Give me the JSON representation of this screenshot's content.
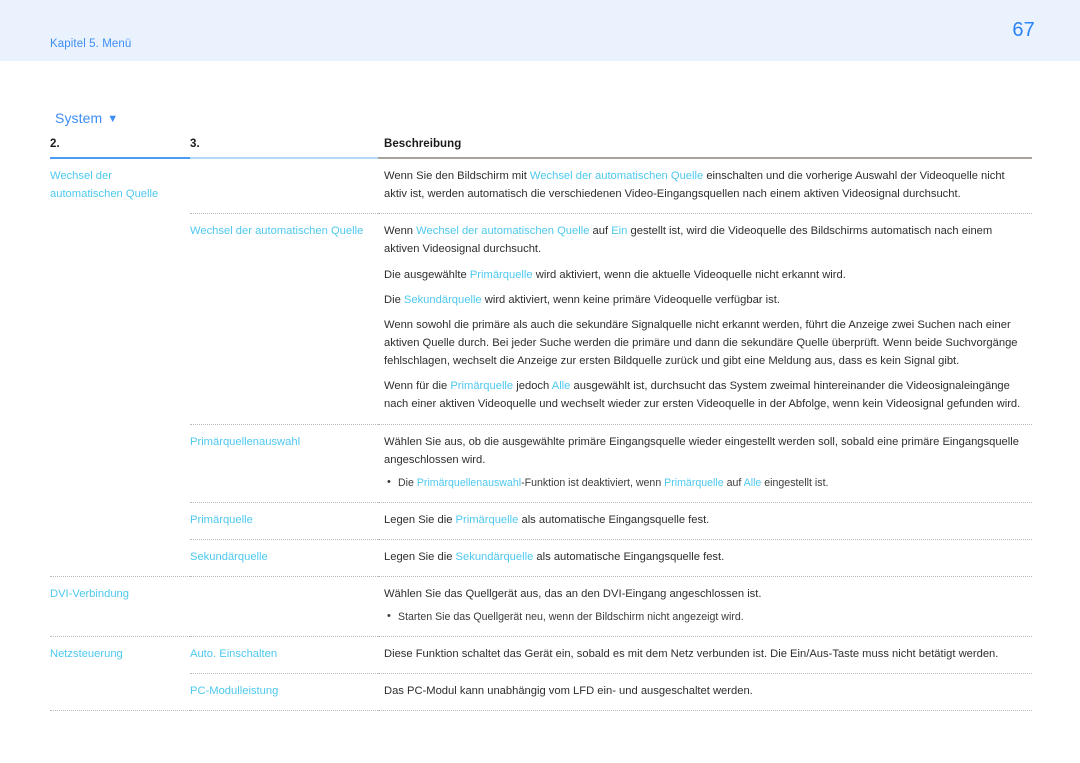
{
  "header": {
    "chapter": "Kapitel 5. Menü",
    "page_number": "67"
  },
  "section": {
    "title": "System",
    "caret": "▼"
  },
  "table": {
    "columns": [
      "2.",
      "3.",
      "Beschreibung"
    ],
    "rows": [
      {
        "level1": "Wechsel der automatischen Quelle",
        "level2": "",
        "paragraphs": [
          {
            "parts": [
              {
                "t": "Wenn Sie den Bildschirm mit ",
                "hl": false
              },
              {
                "t": "Wechsel der automatischen Quelle",
                "hl": true
              },
              {
                "t": " einschalten und die vorherige Auswahl der Videoquelle nicht aktiv ist, werden automatisch die verschiedenen Video-Eingangsquellen nach einem aktiven Videosignal durchsucht.",
                "hl": false
              }
            ]
          }
        ],
        "bullets": []
      },
      {
        "level1": "",
        "level2": "Wechsel der automatischen Quelle",
        "paragraphs": [
          {
            "parts": [
              {
                "t": "Wenn ",
                "hl": false
              },
              {
                "t": "Wechsel der automatischen Quelle",
                "hl": true
              },
              {
                "t": " auf ",
                "hl": false
              },
              {
                "t": "Ein",
                "hl": true
              },
              {
                "t": " gestellt ist, wird die Videoquelle des Bildschirms automatisch nach einem aktiven Videosignal durchsucht.",
                "hl": false
              }
            ]
          },
          {
            "parts": [
              {
                "t": "Die ausgewählte ",
                "hl": false
              },
              {
                "t": "Primärquelle",
                "hl": true
              },
              {
                "t": " wird aktiviert, wenn die aktuelle Videoquelle nicht erkannt wird.",
                "hl": false
              }
            ]
          },
          {
            "parts": [
              {
                "t": "Die ",
                "hl": false
              },
              {
                "t": "Sekundärquelle",
                "hl": true
              },
              {
                "t": " wird aktiviert, wenn keine primäre Videoquelle verfügbar ist.",
                "hl": false
              }
            ]
          },
          {
            "parts": [
              {
                "t": "Wenn sowohl die primäre als auch die sekundäre Signalquelle nicht erkannt werden, führt die Anzeige zwei Suchen nach einer aktiven Quelle durch. Bei jeder Suche werden die primäre und dann die sekundäre Quelle überprüft. Wenn beide Suchvorgänge fehlschlagen, wechselt die Anzeige zur ersten Bildquelle zurück und gibt eine Meldung aus, dass es kein Signal gibt.",
                "hl": false
              }
            ]
          },
          {
            "parts": [
              {
                "t": "Wenn für die ",
                "hl": false
              },
              {
                "t": "Primärquelle",
                "hl": true
              },
              {
                "t": " jedoch ",
                "hl": false
              },
              {
                "t": "Alle",
                "hl": true
              },
              {
                "t": " ausgewählt ist, durchsucht das System zweimal hintereinander die Videosignaleingänge nach einer aktiven Videoquelle und wechselt wieder zur ersten Videoquelle in der Abfolge, wenn kein Videosignal gefunden wird.",
                "hl": false
              }
            ]
          }
        ],
        "bullets": []
      },
      {
        "level1": "",
        "level2": "Primärquellenauswahl",
        "paragraphs": [
          {
            "parts": [
              {
                "t": "Wählen Sie aus, ob die ausgewählte primäre Eingangsquelle wieder eingestellt werden soll, sobald eine primäre Eingangsquelle angeschlossen wird.",
                "hl": false
              }
            ]
          }
        ],
        "bullets": [
          {
            "parts": [
              {
                "t": "Die ",
                "hl": false
              },
              {
                "t": "Primärquellenauswahl",
                "hl": true
              },
              {
                "t": "-Funktion ist deaktiviert, wenn ",
                "hl": false
              },
              {
                "t": "Primärquelle",
                "hl": true
              },
              {
                "t": " auf ",
                "hl": false
              },
              {
                "t": "Alle",
                "hl": true
              },
              {
                "t": " eingestellt ist.",
                "hl": false
              }
            ]
          }
        ]
      },
      {
        "level1": "",
        "level2": "Primärquelle",
        "paragraphs": [
          {
            "parts": [
              {
                "t": "Legen Sie die ",
                "hl": false
              },
              {
                "t": "Primärquelle",
                "hl": true
              },
              {
                "t": " als automatische Eingangsquelle fest.",
                "hl": false
              }
            ]
          }
        ],
        "bullets": []
      },
      {
        "level1": "",
        "level2": "Sekundärquelle",
        "paragraphs": [
          {
            "parts": [
              {
                "t": "Legen Sie die ",
                "hl": false
              },
              {
                "t": "Sekundärquelle",
                "hl": true
              },
              {
                "t": " als automatische Eingangsquelle fest.",
                "hl": false
              }
            ]
          }
        ],
        "bullets": []
      },
      {
        "level1": "DVI-Verbindung",
        "level2": "",
        "paragraphs": [
          {
            "parts": [
              {
                "t": "Wählen Sie das Quellgerät aus, das an den DVI-Eingang angeschlossen ist.",
                "hl": false
              }
            ]
          }
        ],
        "bullets": [
          {
            "parts": [
              {
                "t": "Starten Sie das Quellgerät neu, wenn der Bildschirm nicht angezeigt wird.",
                "hl": false
              }
            ]
          }
        ]
      },
      {
        "level1": "Netzsteuerung",
        "level2": "Auto. Einschalten",
        "paragraphs": [
          {
            "parts": [
              {
                "t": "Diese Funktion schaltet das Gerät ein, sobald es mit dem Netz verbunden ist. Die Ein/Aus-Taste muss nicht betätigt werden.",
                "hl": false
              }
            ]
          }
        ],
        "bullets": []
      },
      {
        "level1": "",
        "level2": "PC-Modulleistung",
        "paragraphs": [
          {
            "parts": [
              {
                "t": "Das PC-Modul kann unabhängig vom LFD ein- und ausgeschaltet werden.",
                "hl": false
              }
            ]
          }
        ],
        "bullets": []
      }
    ]
  },
  "colors": {
    "header_band": "#eaf2fd",
    "chapter_text": "#3d8df5",
    "page_number": "#2a84f7",
    "section_title": "#3d8df5",
    "highlight_term": "#4ec8ee",
    "rule_col1": "#4a9bf7",
    "rule_col2": "#b4d8fc",
    "rule_col3": "#a8a49c",
    "divider": "#b9b9b9",
    "body_text": "#2e2e2e"
  }
}
